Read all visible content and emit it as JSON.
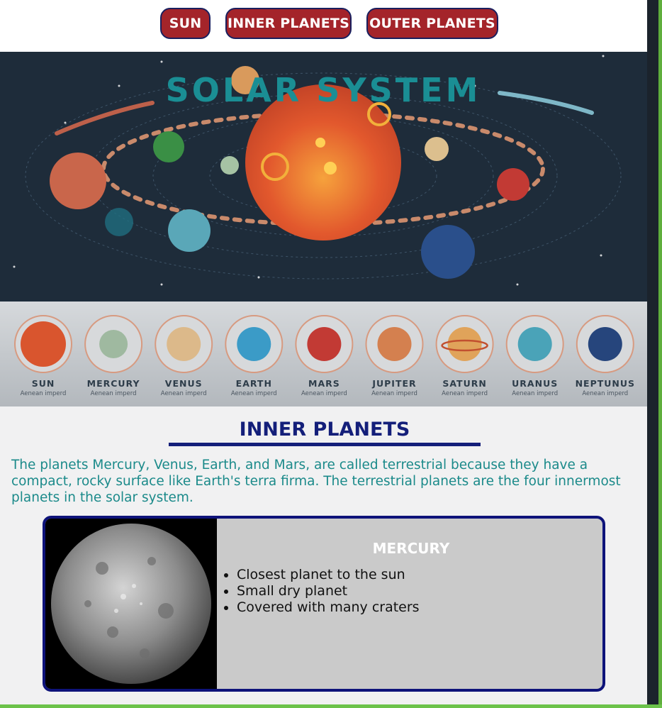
{
  "nav": {
    "buttons": [
      {
        "label": "SUN"
      },
      {
        "label": "INNER PLANETS"
      },
      {
        "label": "OUTER PLANETS"
      }
    ]
  },
  "hero": {
    "title": "SOLAR SYSTEM",
    "planets": [
      {
        "name": "SUN",
        "sub": "Aenean imperd",
        "color": "#d9552e"
      },
      {
        "name": "MERCURY",
        "sub": "Aenean imperd",
        "color": "#9fb9a0"
      },
      {
        "name": "VENUS",
        "sub": "Aenean imperd",
        "color": "#dcb98a"
      },
      {
        "name": "EARTH",
        "sub": "Aenean imperd",
        "color": "#3b9bc7"
      },
      {
        "name": "MARS",
        "sub": "Aenean imperd",
        "color": "#c23a34"
      },
      {
        "name": "JUPITER",
        "sub": "Aenean imperd",
        "color": "#d4804f"
      },
      {
        "name": "SATURN",
        "sub": "Aenean imperd",
        "color": "#e0a35a"
      },
      {
        "name": "URANUS",
        "sub": "Aenean imperd",
        "color": "#4aa3b8"
      },
      {
        "name": "NEPTUNUS",
        "sub": "Aenean imperd",
        "color": "#26457c"
      }
    ]
  },
  "section": {
    "title": "INNER PLANETS",
    "intro": "The planets Mercury, Venus, Earth, and Mars, are called terrestrial because they have a compact, rocky surface like Earth's terra firma. The terrestrial planets are the four innermost planets in the solar system."
  },
  "card": {
    "title": "MERCURY",
    "facts": [
      "Closest planet to the sun",
      "Small dry planet",
      "Covered with many craters"
    ]
  },
  "colors": {
    "accent_red": "#a4242a",
    "navy": "#141f7a",
    "teal": "#1b8a8a"
  }
}
